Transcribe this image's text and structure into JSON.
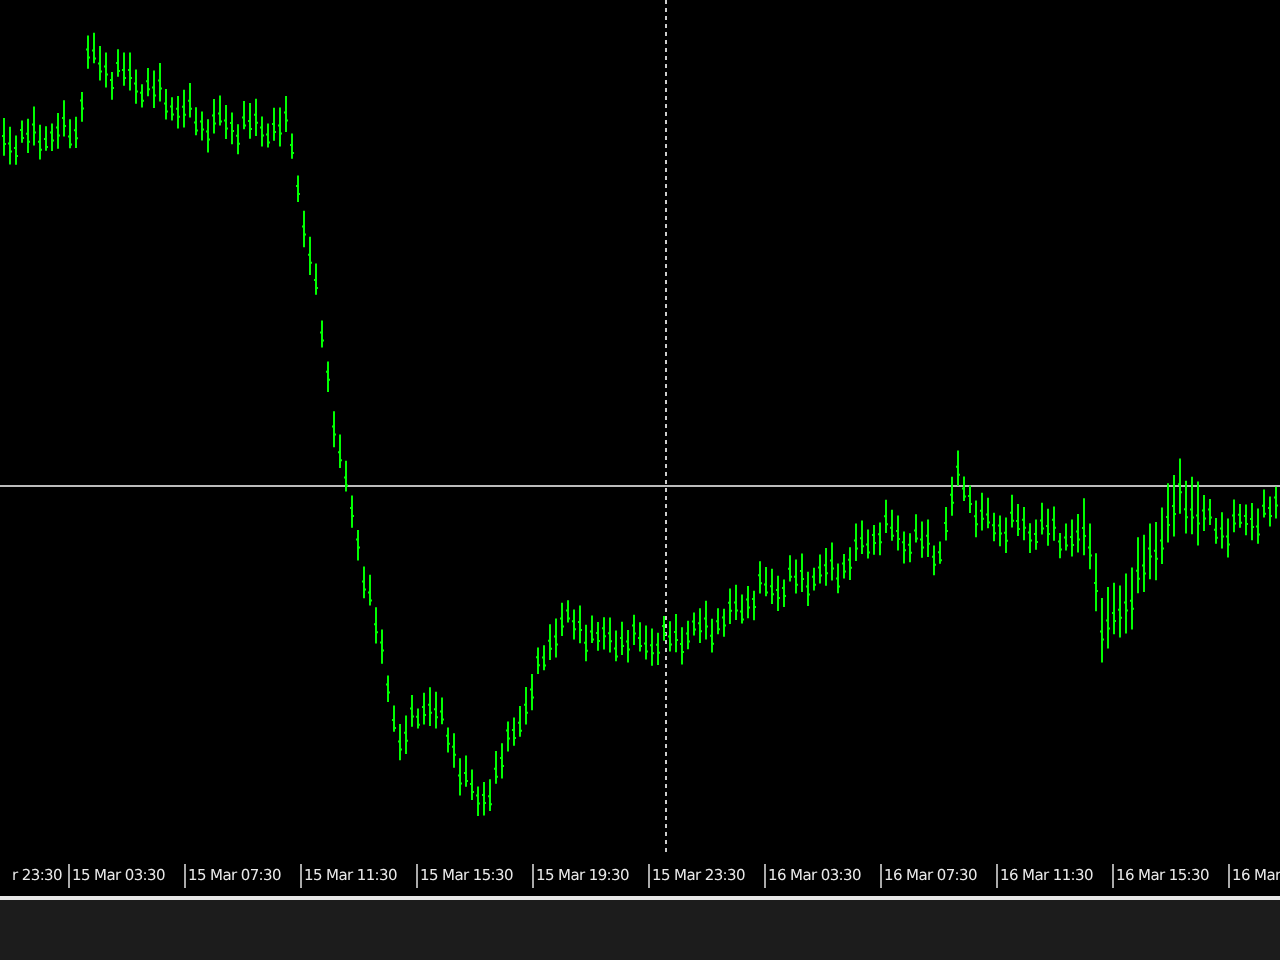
{
  "chart": {
    "time_axis": {
      "labels": [
        "r 23:30",
        "15 Mar 03:30",
        "15 Mar 07:30",
        "15 Mar 11:30",
        "15 Mar 15:30",
        "15 Mar 19:30",
        "15 Mar 23:30",
        "16 Mar 03:30",
        "16 Mar 07:30",
        "16 Mar 11:30",
        "16 Mar 15:30",
        "16 Mar"
      ]
    }
  }
}
